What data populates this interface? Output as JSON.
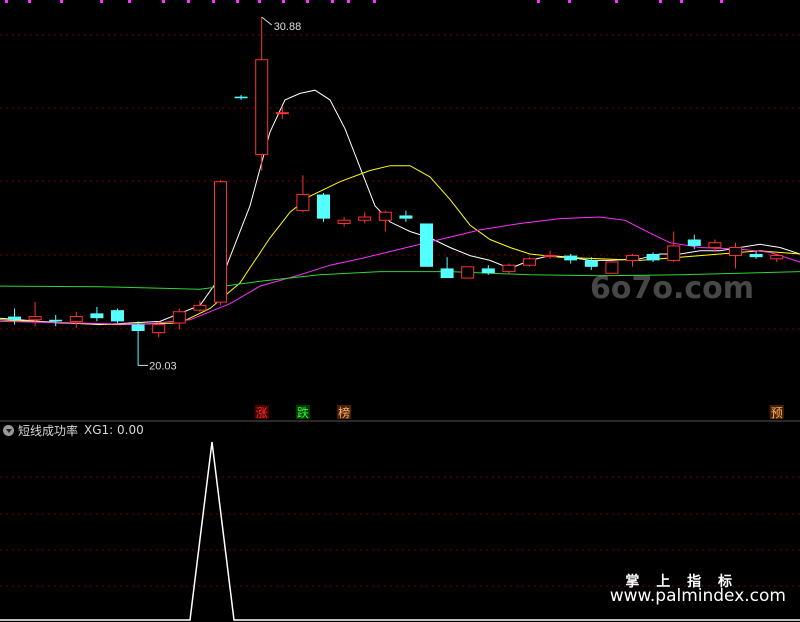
{
  "chart_data": {
    "type": "candlestick",
    "price_range": [
      18.64,
      31.41
    ],
    "high_label": "30.88",
    "low_label": "20.03",
    "candles": [
      {
        "o": 21.55,
        "c": 21.45,
        "h": 21.8,
        "l": 21.3
      },
      {
        "o": 21.45,
        "c": 21.55,
        "h": 22.0,
        "l": 21.25
      },
      {
        "o": 21.45,
        "c": 21.4,
        "h": 21.6,
        "l": 21.25
      },
      {
        "o": 21.4,
        "c": 21.55,
        "h": 21.7,
        "l": 21.2
      },
      {
        "o": 21.65,
        "c": 21.5,
        "h": 21.85,
        "l": 21.4
      },
      {
        "o": 21.75,
        "c": 21.4,
        "h": 21.8,
        "l": 21.35
      },
      {
        "o": 21.3,
        "c": 21.1,
        "h": 21.4,
        "l": 20.03
      },
      {
        "o": 21.05,
        "c": 21.3,
        "h": 21.4,
        "l": 20.9
      },
      {
        "o": 21.35,
        "c": 21.7,
        "h": 21.8,
        "l": 21.15
      },
      {
        "o": 21.75,
        "c": 21.9,
        "h": 22.05,
        "l": 21.7
      },
      {
        "o": 22.0,
        "c": 25.75,
        "h": 25.8,
        "l": 21.9
      },
      {
        "o": 28.4,
        "c": 28.35,
        "h": 28.45,
        "l": 28.3
      },
      {
        "o": 26.6,
        "c": 29.55,
        "h": 30.88,
        "l": 26.1
      },
      {
        "o": 27.9,
        "c": 27.9,
        "h": 28.1,
        "l": 27.7
      },
      {
        "o": 24.85,
        "c": 25.35,
        "h": 25.95,
        "l": 24.8
      },
      {
        "o": 25.35,
        "c": 24.6,
        "h": 25.4,
        "l": 24.5
      },
      {
        "o": 24.45,
        "c": 24.55,
        "h": 24.65,
        "l": 24.35
      },
      {
        "o": 24.55,
        "c": 24.65,
        "h": 24.8,
        "l": 24.45
      },
      {
        "o": 24.55,
        "c": 24.8,
        "h": 24.85,
        "l": 24.2
      },
      {
        "o": 24.7,
        "c": 24.6,
        "h": 24.85,
        "l": 24.5
      },
      {
        "o": 24.45,
        "c": 23.1,
        "h": 24.45,
        "l": 23.1
      },
      {
        "o": 23.05,
        "c": 22.75,
        "h": 23.4,
        "l": 22.75
      },
      {
        "o": 22.75,
        "c": 23.1,
        "h": 23.1,
        "l": 22.75
      },
      {
        "o": 23.05,
        "c": 22.9,
        "h": 23.15,
        "l": 22.85
      },
      {
        "o": 22.95,
        "c": 23.15,
        "h": 23.2,
        "l": 22.9
      },
      {
        "o": 23.15,
        "c": 23.35,
        "h": 23.4,
        "l": 23.1
      },
      {
        "o": 23.45,
        "c": 23.45,
        "h": 23.6,
        "l": 23.35
      },
      {
        "o": 23.45,
        "c": 23.3,
        "h": 23.5,
        "l": 23.2
      },
      {
        "o": 23.3,
        "c": 23.1,
        "h": 23.4,
        "l": 23.0
      },
      {
        "o": 22.9,
        "c": 23.25,
        "h": 23.3,
        "l": 22.9
      },
      {
        "o": 23.3,
        "c": 23.45,
        "h": 23.5,
        "l": 23.1
      },
      {
        "o": 23.5,
        "c": 23.3,
        "h": 23.55,
        "l": 23.25
      },
      {
        "o": 23.3,
        "c": 23.75,
        "h": 24.2,
        "l": 23.25
      },
      {
        "o": 23.95,
        "c": 23.75,
        "h": 24.1,
        "l": 23.65
      },
      {
        "o": 23.7,
        "c": 23.85,
        "h": 23.95,
        "l": 23.55
      },
      {
        "o": 23.45,
        "c": 23.7,
        "h": 23.85,
        "l": 23.05
      },
      {
        "o": 23.5,
        "c": 23.4,
        "h": 23.6,
        "l": 23.35
      },
      {
        "o": 23.35,
        "c": 23.45,
        "h": 23.5,
        "l": 23.25
      }
    ],
    "ma_lines": [
      {
        "color": "#ffffff",
        "points": [
          [
            0,
            21.5
          ],
          [
            40,
            21.4
          ],
          [
            100,
            21.3
          ],
          [
            160,
            21.4
          ],
          [
            200,
            21.9
          ],
          [
            225,
            23.0
          ],
          [
            250,
            25.0
          ],
          [
            270,
            27.3
          ],
          [
            285,
            28.3
          ],
          [
            300,
            28.5
          ],
          [
            315,
            28.6
          ],
          [
            330,
            28.3
          ],
          [
            345,
            27.4
          ],
          [
            360,
            26.2
          ],
          [
            375,
            25.0
          ],
          [
            390,
            24.5
          ],
          [
            410,
            24.2
          ],
          [
            430,
            24.0
          ],
          [
            450,
            23.7
          ],
          [
            470,
            23.45
          ],
          [
            490,
            23.3
          ],
          [
            510,
            23.05
          ],
          [
            530,
            23.3
          ],
          [
            550,
            23.45
          ],
          [
            570,
            23.4
          ],
          [
            590,
            23.3
          ],
          [
            610,
            23.3
          ],
          [
            640,
            23.35
          ],
          [
            660,
            23.5
          ],
          [
            680,
            23.5
          ],
          [
            700,
            23.6
          ],
          [
            720,
            23.6
          ],
          [
            740,
            23.7
          ],
          [
            760,
            23.8
          ],
          [
            780,
            23.7
          ],
          [
            800,
            23.5
          ]
        ]
      },
      {
        "color": "#ffff00",
        "points": [
          [
            0,
            21.45
          ],
          [
            60,
            21.35
          ],
          [
            120,
            21.3
          ],
          [
            180,
            21.35
          ],
          [
            210,
            21.8
          ],
          [
            240,
            22.6
          ],
          [
            270,
            24.0
          ],
          [
            290,
            24.8
          ],
          [
            310,
            25.3
          ],
          [
            340,
            25.75
          ],
          [
            370,
            26.1
          ],
          [
            390,
            26.25
          ],
          [
            410,
            26.25
          ],
          [
            430,
            25.9
          ],
          [
            450,
            25.2
          ],
          [
            470,
            24.4
          ],
          [
            490,
            23.95
          ],
          [
            510,
            23.7
          ],
          [
            530,
            23.5
          ],
          [
            560,
            23.4
          ],
          [
            600,
            23.35
          ],
          [
            640,
            23.3
          ],
          [
            680,
            23.4
          ],
          [
            720,
            23.5
          ],
          [
            760,
            23.6
          ],
          [
            800,
            23.5
          ]
        ]
      },
      {
        "color": "#ff2fff",
        "points": [
          [
            0,
            21.4
          ],
          [
            80,
            21.35
          ],
          [
            140,
            21.3
          ],
          [
            190,
            21.45
          ],
          [
            230,
            21.95
          ],
          [
            260,
            22.5
          ],
          [
            300,
            22.85
          ],
          [
            330,
            23.15
          ],
          [
            360,
            23.35
          ],
          [
            400,
            23.65
          ],
          [
            440,
            23.95
          ],
          [
            480,
            24.25
          ],
          [
            520,
            24.45
          ],
          [
            560,
            24.6
          ],
          [
            600,
            24.65
          ],
          [
            625,
            24.55
          ],
          [
            650,
            24.15
          ],
          [
            670,
            23.85
          ],
          [
            700,
            23.7
          ],
          [
            740,
            23.65
          ],
          [
            770,
            23.55
          ],
          [
            800,
            23.25
          ]
        ]
      },
      {
        "color": "#2fd62f",
        "points": [
          [
            0,
            22.5
          ],
          [
            100,
            22.48
          ],
          [
            200,
            22.4
          ],
          [
            260,
            22.65
          ],
          [
            320,
            22.85
          ],
          [
            380,
            22.95
          ],
          [
            450,
            22.95
          ],
          [
            530,
            22.85
          ],
          [
            600,
            22.82
          ],
          [
            680,
            22.85
          ],
          [
            740,
            22.9
          ],
          [
            800,
            22.95
          ]
        ]
      }
    ],
    "signals": [
      {
        "label": "涨",
        "color": "#ff3030",
        "bg": "#4a0000",
        "index": 12
      },
      {
        "label": "跌",
        "color": "#30ff30",
        "bg": "#003a00",
        "index": 14
      },
      {
        "label": "榜",
        "color": "#ffb070",
        "bg": "#4a2200",
        "index": 16
      },
      {
        "label": "预",
        "color": "#ffb070",
        "bg": "#4a2200",
        "index": 37
      }
    ],
    "sub_panel": {
      "name": "短线成功率",
      "value_label": "XG1: 0.00",
      "color": "#ffffff",
      "range": [
        0,
        1
      ],
      "points": [
        [
          0,
          0
        ],
        [
          190,
          0
        ],
        [
          212,
          1
        ],
        [
          234,
          0
        ],
        [
          800,
          0
        ]
      ]
    },
    "colors": {
      "up": "#ff3232",
      "down": "#54ffff",
      "grid": "#7a0000",
      "axis": "#555555"
    }
  },
  "watermark": {
    "cn": "掌 上 指 标",
    "url": "www.palmindex.com",
    "site": "6o7o.com"
  }
}
